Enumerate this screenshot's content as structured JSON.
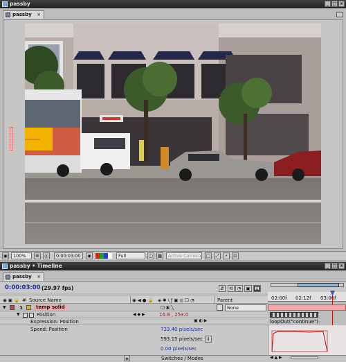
{
  "comp_window": {
    "title": "passby",
    "tab_label": "passby",
    "tab_close": "×"
  },
  "viewer_toolbar": {
    "zoom": "100%",
    "timecode": "0:00:03:00",
    "resolution": "Full",
    "camera": "Active Camera"
  },
  "timeline_window": {
    "title": "passby • Timeline",
    "tab_label": "passby",
    "tab_close": "×",
    "current_time": "0:00:03:00",
    "fps": "(29.97 fps)",
    "ruler_labels": [
      "02:00f",
      "02:12f",
      "03:00f"
    ],
    "columns": {
      "source_name": "Source Name",
      "parent": "Parent"
    },
    "layer": {
      "number": "1",
      "name": "temp solid",
      "parent": "None"
    },
    "position": {
      "label": "Position",
      "value": "16.8 , 253.0"
    },
    "expression": {
      "label": "Expression: Position",
      "code": "loopOut(\"continue\")"
    },
    "speed": {
      "label": "Speed: Position",
      "values": [
        "733.40 pixels/sec",
        "593.15 pixels/sec",
        "0.00 pixels/sec"
      ]
    },
    "footer": {
      "switches_modes": "Switches / Modes"
    }
  },
  "colors": {
    "title_bar": "#2c2c2c",
    "panel": "#bdbdbd",
    "label_red": "#d84040",
    "layer_highlight": "#f2a8a8",
    "accent_blue": "#1c2f9e"
  }
}
